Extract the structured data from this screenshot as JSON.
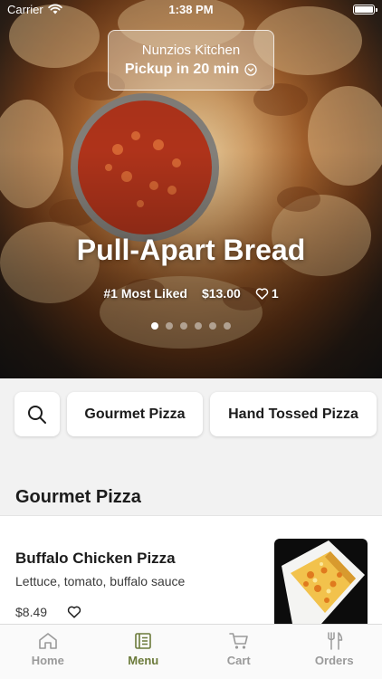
{
  "status_bar": {
    "carrier": "Carrier",
    "time": "1:38 PM"
  },
  "pickup": {
    "restaurant": "Nunzios Kitchen",
    "label": "Pickup in 20 min"
  },
  "hero": {
    "title": "Pull-Apart Bread",
    "badge": "#1 Most Liked",
    "price": "$13.00",
    "likes": "1",
    "slides_total": 6,
    "slide_active": 1
  },
  "categories": {
    "search_icon": "search-icon",
    "chips": [
      "Gourmet Pizza",
      "Hand Tossed Pizza"
    ]
  },
  "section": {
    "title": "Gourmet Pizza"
  },
  "item": {
    "name": "Buffalo Chicken Pizza",
    "description": "Lettuce, tomato, buffalo sauce",
    "price": "$8.49"
  },
  "tabs": [
    {
      "label": "Home",
      "icon": "home-icon",
      "active": false
    },
    {
      "label": "Menu",
      "icon": "menu-icon",
      "active": true
    },
    {
      "label": "Cart",
      "icon": "cart-icon",
      "active": false
    },
    {
      "label": "Orders",
      "icon": "utensils-icon",
      "active": false
    }
  ],
  "colors": {
    "accent": "#6b7a3a",
    "inactive": "#9a9a9a",
    "background": "#f2f2f2"
  }
}
